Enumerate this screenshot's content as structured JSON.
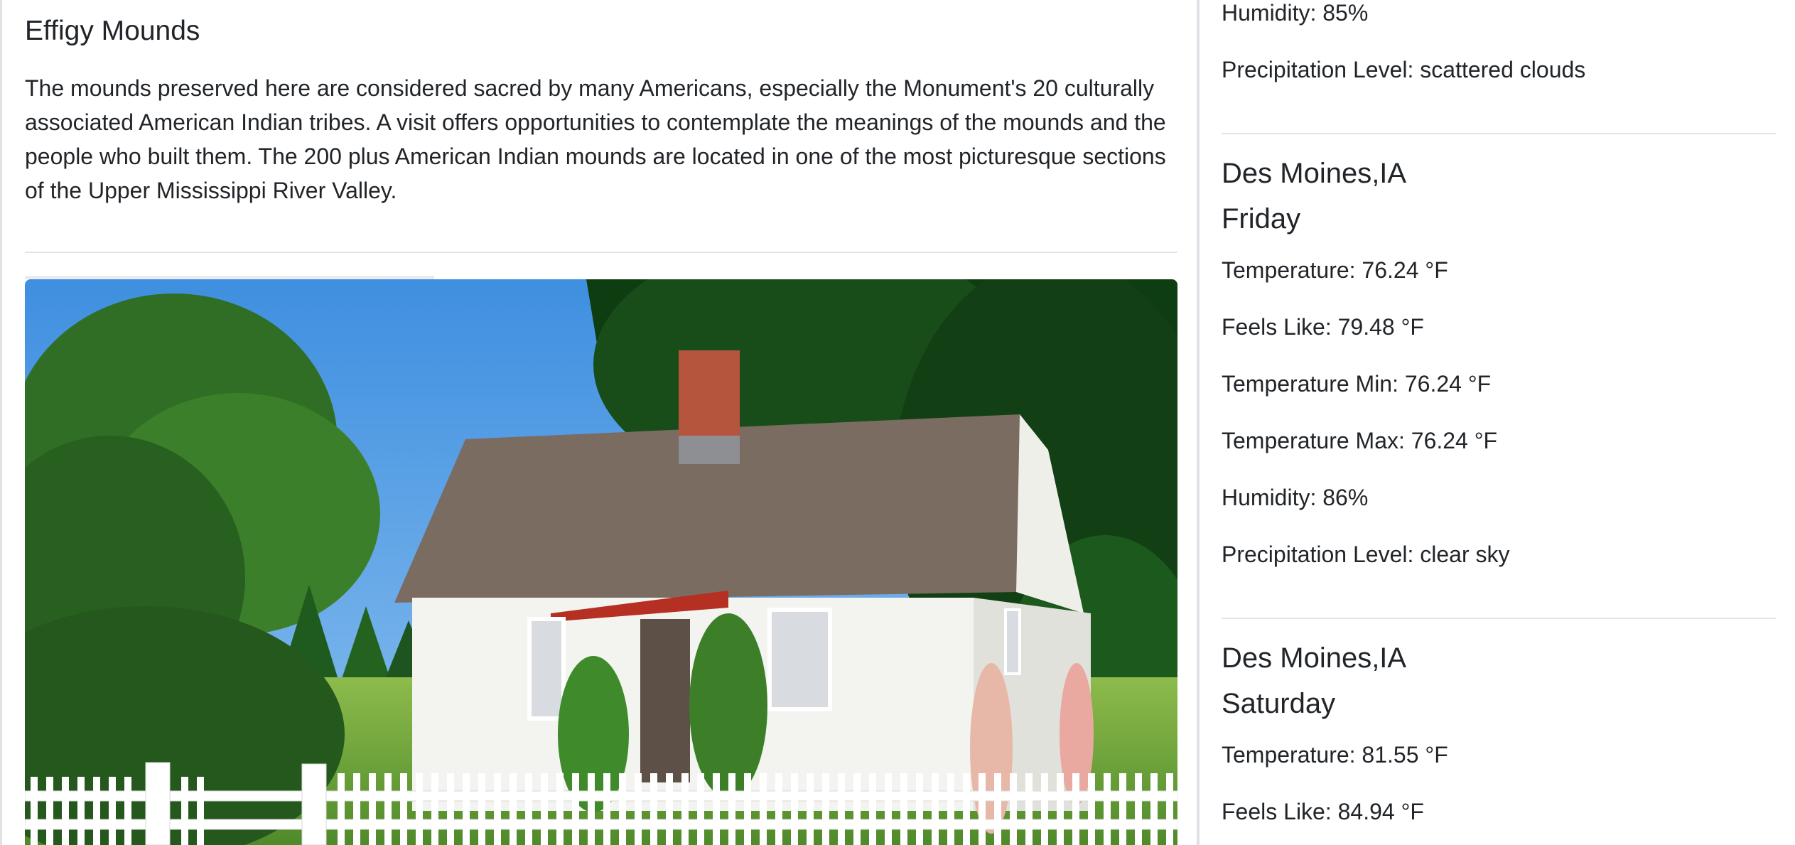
{
  "park": {
    "title": "Effigy Mounds",
    "description": "The mounds preserved here are considered sacred by many Americans, especially the Monument's 20 culturally associated American Indian tribes. A visit offers opportunities to contemplate the meanings of the mounds and the people who built them. The 200 plus American Indian mounds are located in one of the most picturesque sections of the Upper Mississippi River Valley."
  },
  "weather": {
    "prev": {
      "humidity": "Humidity: 85%",
      "precipitation": "Precipitation Level: scattered clouds"
    },
    "friday": {
      "city": "Des Moines,IA",
      "day": "Friday",
      "temperature": "Temperature: 76.24 °F",
      "feels_like": "Feels Like: 79.48 °F",
      "temp_min": "Temperature Min: 76.24 °F",
      "temp_max": "Temperature Max: 76.24 °F",
      "humidity": "Humidity: 86%",
      "precipitation": "Precipitation Level: clear sky"
    },
    "saturday": {
      "city": "Des Moines,IA",
      "day": "Saturday",
      "temperature": "Temperature: 81.55 °F",
      "feels_like": "Feels Like: 84.94 °F"
    }
  }
}
